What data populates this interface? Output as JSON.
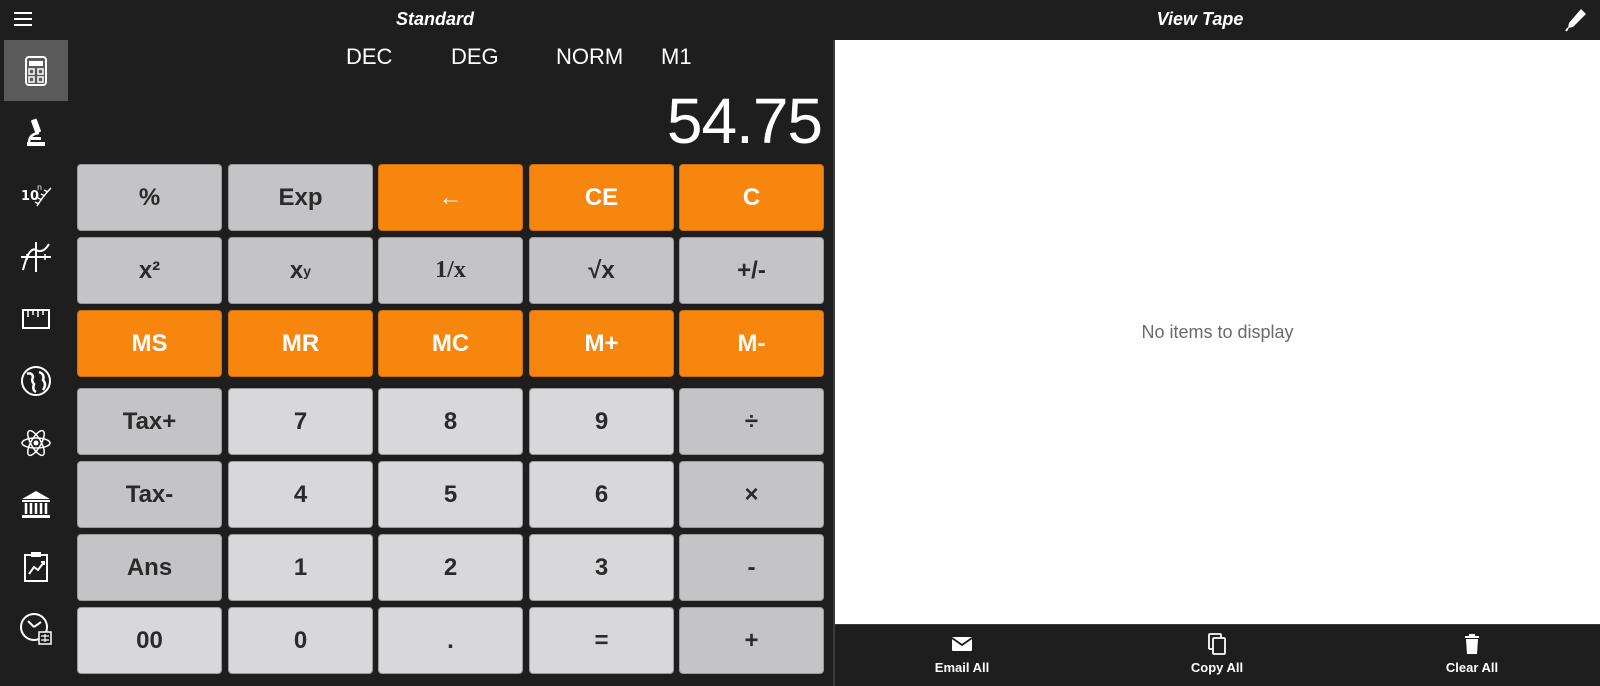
{
  "header": {
    "left_title": "Standard",
    "right_title": "View Tape"
  },
  "indicators": {
    "base": "DEC",
    "angle": "DEG",
    "notation": "NORM",
    "memory": "M1"
  },
  "display": {
    "value": "54.75"
  },
  "keys": {
    "percent": "%",
    "exp": "Exp",
    "backspace": "←",
    "ce": "CE",
    "c": "C",
    "square": "x²",
    "power_base": "x",
    "power_exp": "y",
    "reciprocal": "1/x",
    "sqrt": "√x",
    "negate": "+/-",
    "ms": "MS",
    "mr": "MR",
    "mc": "MC",
    "mplus": "M+",
    "mminus": "M-",
    "tax_plus": "Tax+",
    "seven": "7",
    "eight": "8",
    "nine": "9",
    "divide": "÷",
    "tax_minus": "Tax-",
    "four": "4",
    "five": "5",
    "six": "6",
    "multiply": "×",
    "ans": "Ans",
    "one": "1",
    "two": "2",
    "three": "3",
    "minus": "-",
    "double_zero": "00",
    "zero": "0",
    "decimal": ".",
    "equals": "=",
    "plus": "+"
  },
  "tape": {
    "empty_message": "No items to display",
    "email_all": "Email All",
    "copy_all": "Copy All",
    "clear_all": "Clear All"
  },
  "sidebar": {
    "items": [
      {
        "icon": "calculator-icon"
      },
      {
        "icon": "microscope-icon"
      },
      {
        "icon": "scientific-notation-icon"
      },
      {
        "icon": "graph-icon"
      },
      {
        "icon": "ruler-icon"
      },
      {
        "icon": "globe-icon"
      },
      {
        "icon": "atom-icon"
      },
      {
        "icon": "bank-icon"
      },
      {
        "icon": "chart-clipboard-icon"
      },
      {
        "icon": "clock-calculator-icon"
      }
    ]
  },
  "colors": {
    "background": "#1e1e1e",
    "accent": "#f7860f",
    "key_gray": "#c4c4c6",
    "key_light": "#d8d8da",
    "tape_bg": "#ffffff"
  }
}
